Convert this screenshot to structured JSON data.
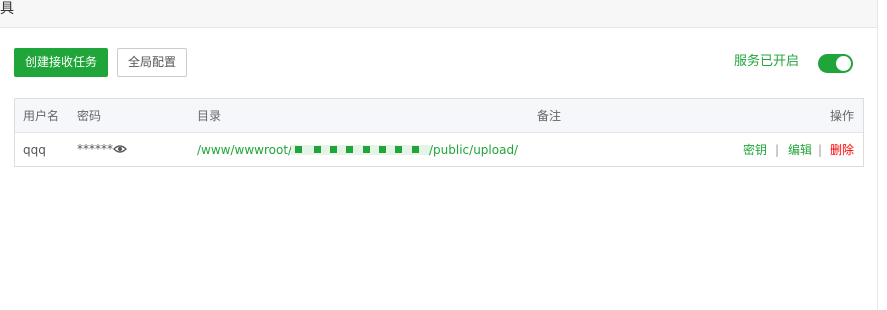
{
  "window": {
    "title": "具"
  },
  "toolbar": {
    "create_label": "创建接收任务",
    "global_config_label": "全局配置"
  },
  "service": {
    "status_label": "服务已开启",
    "enabled": true
  },
  "table": {
    "headers": {
      "username": "用户名",
      "password": "密码",
      "directory": "目录",
      "remark": "备注",
      "actions": "操作"
    },
    "rows": [
      {
        "username": "qqq",
        "password": "******",
        "path_prefix": "/www/wwwroot/",
        "path_suffix": "/public/upload/",
        "remark": "",
        "actions": {
          "key": "密钥",
          "edit": "编辑",
          "delete": "删除",
          "separator": "|"
        }
      }
    ]
  },
  "colors": {
    "accent": "#20a53a",
    "danger": "#ff0000",
    "header_bg": "#f6f7fb"
  },
  "icons": {
    "visibility": "eye-icon"
  }
}
